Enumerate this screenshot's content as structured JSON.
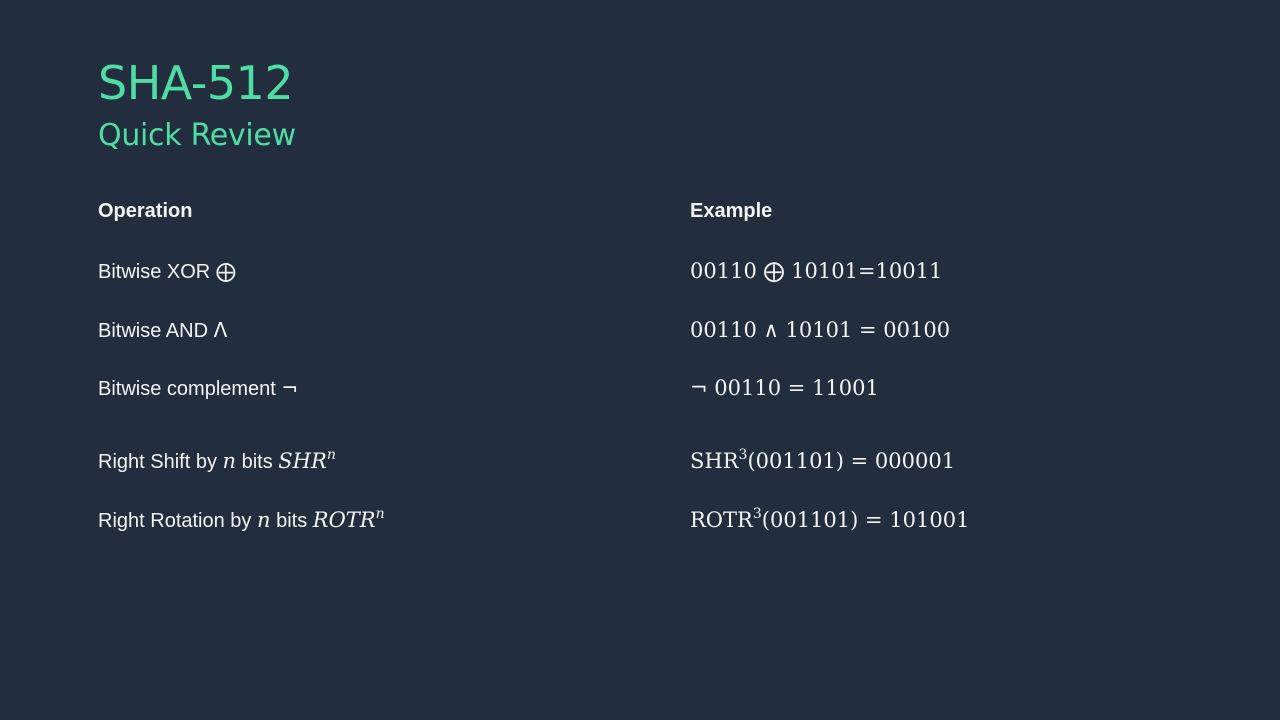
{
  "slide": {
    "title": "SHA-512",
    "subtitle": "Quick Review"
  },
  "table": {
    "headers": {
      "operation": "Operation",
      "example": "Example"
    },
    "rows": [
      {
        "label": "Bitwise XOR",
        "symbol": "⨁",
        "example": "00110 ⨁ 10101=10011"
      },
      {
        "label": "Bitwise AND",
        "symbol": "Λ",
        "example": "00110 ∧ 10101 = 00100"
      },
      {
        "label": "Bitwise complement",
        "symbol": "¬",
        "example": "¬ 00110 = 11001"
      },
      {
        "label_pre": "Right Shift by",
        "n": "n",
        "label_mid": "bits",
        "op": "SHR",
        "sup": "n",
        "example_op": "SHR",
        "example_sup": "3",
        "example_rest": "(001101) = 000001"
      },
      {
        "label_pre": "Right Rotation by",
        "n": "n",
        "label_mid": "bits",
        "op": "ROTR",
        "sup": "n",
        "example_op": "ROTR",
        "example_sup": "3",
        "example_rest": "(001101) = 101001"
      }
    ]
  }
}
